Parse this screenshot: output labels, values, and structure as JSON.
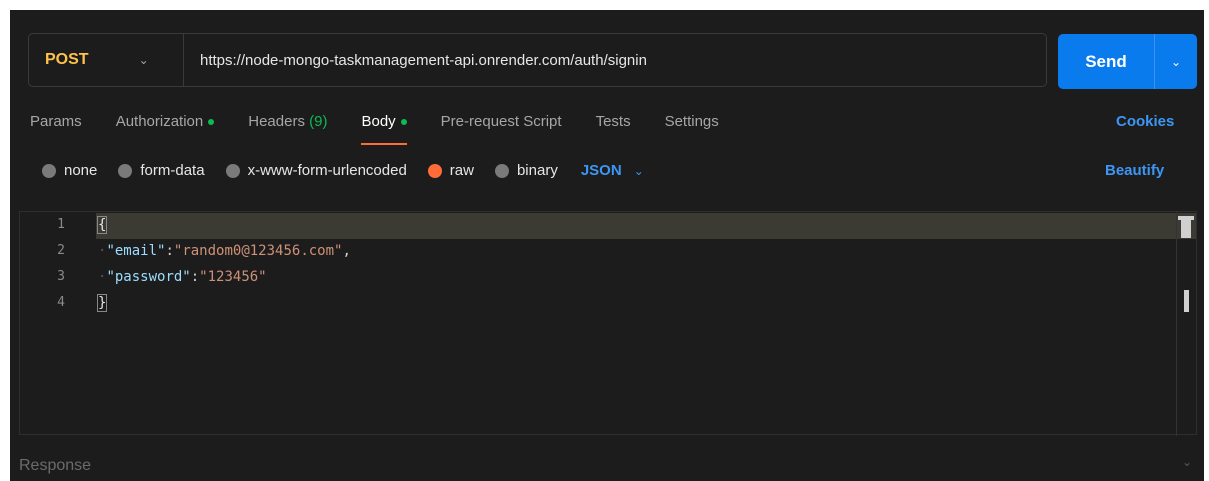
{
  "request": {
    "method": "POST",
    "url": "https://node-mongo-taskmanagement-api.onrender.com/auth/signin",
    "send_label": "Send"
  },
  "tabs": {
    "params": "Params",
    "authorization": "Authorization",
    "headers": "Headers",
    "headers_count": "(9)",
    "body": "Body",
    "prerequest": "Pre-request Script",
    "tests": "Tests",
    "settings": "Settings",
    "cookies": "Cookies"
  },
  "body_types": {
    "none": "none",
    "form_data": "form-data",
    "urlencoded": "x-www-form-urlencoded",
    "raw": "raw",
    "binary": "binary",
    "format": "JSON",
    "beautify": "Beautify"
  },
  "editor": {
    "line_numbers": [
      "1",
      "2",
      "3",
      "4"
    ],
    "open_brace": "{",
    "close_brace": "}",
    "key_email": "\"email\"",
    "value_email": "\"random0@123456.com\"",
    "key_password": "\"password\"",
    "value_password": "\"123456\""
  },
  "response": {
    "label": "Response"
  },
  "colors": {
    "accent": "#ff6c37",
    "send": "#097bed",
    "link": "#3d96f5",
    "method": "#ffc24b",
    "active_dot": "#0cbb52"
  }
}
